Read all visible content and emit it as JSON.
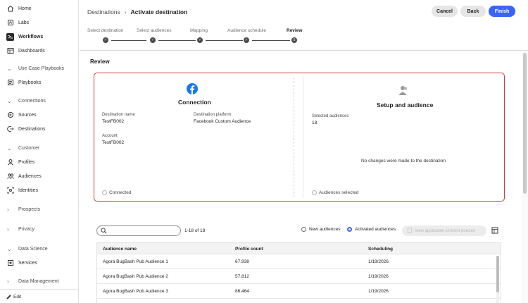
{
  "sidebar": {
    "items": [
      {
        "label": "Home",
        "icon": "home-icon"
      },
      {
        "label": "Labs",
        "icon": "labs-icon"
      },
      {
        "label": "Workflows",
        "icon": "workflows-icon",
        "active": true
      },
      {
        "label": "Dashboards",
        "icon": "dashboards-icon"
      },
      {
        "label": "Use Case Playbooks",
        "icon": "chevron-down-icon",
        "group": true
      },
      {
        "label": "Playbooks",
        "icon": "playbooks-icon"
      },
      {
        "label": "Connections",
        "icon": "chevron-down-icon",
        "group": true
      },
      {
        "label": "Sources",
        "icon": "sources-icon"
      },
      {
        "label": "Destinations",
        "icon": "destinations-icon"
      },
      {
        "label": "Customer",
        "icon": "chevron-down-icon",
        "group": true
      },
      {
        "label": "Profiles",
        "icon": "profiles-icon"
      },
      {
        "label": "Audiences",
        "icon": "audiences-icon"
      },
      {
        "label": "Identities",
        "icon": "identities-icon"
      },
      {
        "label": "Prospects",
        "icon": "chevron-right-icon",
        "group": true
      },
      {
        "label": "Privacy",
        "icon": "chevron-right-icon",
        "group": true
      },
      {
        "label": "Data Science",
        "icon": "chevron-down-icon",
        "group": true
      },
      {
        "label": "Services",
        "icon": "services-icon"
      },
      {
        "label": "Data Management",
        "icon": "chevron-right-icon",
        "group": true
      }
    ],
    "footer_label": "Edit"
  },
  "header": {
    "breadcrumb_parent": "Destinations",
    "breadcrumb_current": "Activate destination",
    "cancel_label": "Cancel",
    "back_label": "Back",
    "finish_label": "Finish"
  },
  "steps": [
    {
      "label": "Select destination"
    },
    {
      "label": "Select audiences"
    },
    {
      "label": "Mapping"
    },
    {
      "label": "Audience schedule"
    },
    {
      "label": "Review",
      "current": true,
      "number": "5"
    }
  ],
  "review": {
    "title": "Review",
    "connection": {
      "title": "Connection",
      "destination_name_label": "Destination name",
      "destination_name": "TestFB002",
      "platform_label": "Destination platform",
      "platform": "Facebook Custom Audience",
      "account_label": "Account",
      "account": "TestFB002",
      "status": "Connected"
    },
    "setup": {
      "title": "Setup and audience",
      "selected_label": "Selected audiences",
      "selected_count": "18",
      "message": "No changes were made to the destination",
      "status": "Audiences selected"
    }
  },
  "table_toolbar": {
    "search_placeholder": "",
    "count_text": "1-18 of 18",
    "new_audiences_label": "New audiences",
    "activated_audiences_label": "Activated audiences",
    "consent_button_label": "View applicable consent policies"
  },
  "table": {
    "columns": [
      "Audience name",
      "Profile count",
      "Scheduling"
    ],
    "rows": [
      [
        "Agora BugBash Pub Audience 1",
        "67,938",
        "1/19/2026"
      ],
      [
        "Agora BugBash Pub Audience 2",
        "57,812",
        "1/19/2026"
      ],
      [
        "Agora BugBash Pub Audience 3",
        "86,464",
        "1/19/2026"
      ]
    ]
  },
  "colors": {
    "accent": "#3b63fb",
    "highlight_border": "#d7373f",
    "facebook_blue": "#1877f2"
  }
}
